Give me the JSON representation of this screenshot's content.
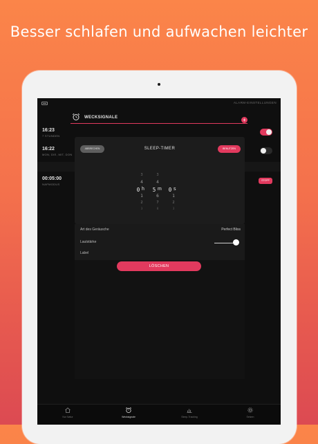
{
  "headline": "Besser schlafen und aufwachen leichter",
  "status": {
    "right_text": "ALARM-EINSTELLUNGEN"
  },
  "section": {
    "title": "WECKSIGNALE",
    "add_label": "+"
  },
  "alarms": [
    {
      "time": "16:23",
      "sub": "7 STUNDEN",
      "toggle_on": true
    },
    {
      "time": "16:22",
      "sub": "MON, DIE, MIT, DON",
      "toggle_on": false
    },
    {
      "time": "00:05:00",
      "sub": "NAPMODUS",
      "action": "STOPP"
    }
  ],
  "sleep_timer": {
    "title": "SLEEP-TIMER",
    "cancel_label": "ABBRECHEN",
    "use_label": "BENUTZEN",
    "hours": {
      "above": [
        "3",
        "4"
      ],
      "selected": "0",
      "below": [
        "1",
        "2",
        "3"
      ],
      "unit": "h"
    },
    "minutes": {
      "above": [
        "3",
        "4"
      ],
      "selected": "5",
      "below": [
        "6",
        "7",
        "8"
      ],
      "unit": "m"
    },
    "seconds": {
      "above": [],
      "selected": "0",
      "below": [
        "1",
        "2",
        "3"
      ],
      "unit": "s"
    }
  },
  "settings": {
    "sound_label": "Art des Geräusche",
    "sound_value": "Perfect Bliss",
    "volume_label": "Lautstärke",
    "volume_level": 1.0,
    "label_label": "Label",
    "delete_label": "LÖSCHEN"
  },
  "tabs": [
    {
      "label": "Nur Natur",
      "icon": "house-icon",
      "active": false
    },
    {
      "label": "Wecksignale",
      "icon": "alarm-clock-icon",
      "active": true
    },
    {
      "label": "Sleep-Tracking",
      "icon": "chart-icon",
      "active": false
    },
    {
      "label": "Setzen",
      "icon": "gear-icon",
      "active": false
    }
  ],
  "colors": {
    "accent": "#e23a5e",
    "toggle_on": "#e23a5e",
    "toggle_off": "#2a2a2a"
  }
}
